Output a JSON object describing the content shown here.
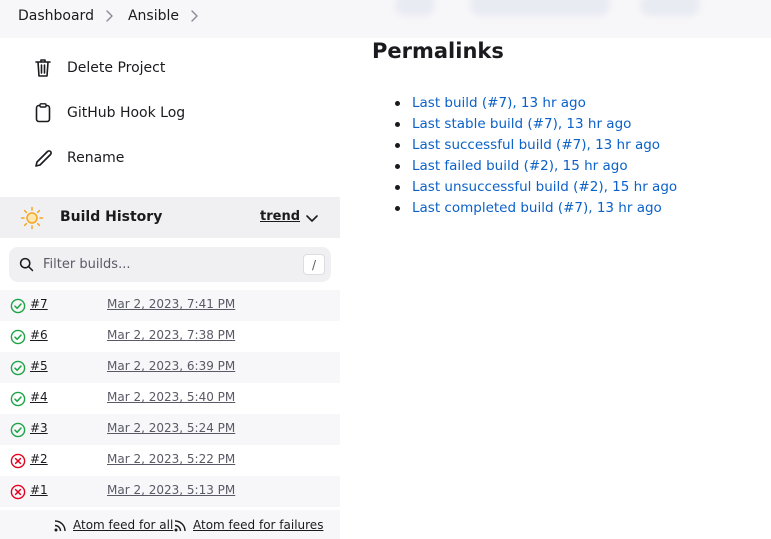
{
  "breadcrumb": {
    "items": [
      "Dashboard",
      "Ansible"
    ]
  },
  "sidebar": {
    "tasks": [
      {
        "label": "Delete Project",
        "icon": "trash-icon"
      },
      {
        "label": "GitHub Hook Log",
        "icon": "clipboard-icon"
      },
      {
        "label": "Rename",
        "icon": "pencil-icon"
      }
    ]
  },
  "build_history": {
    "title": "Build History",
    "trend_label": "trend",
    "filter_placeholder": "Filter builds...",
    "shortcut_key": "/",
    "builds": [
      {
        "number": "#7",
        "time": "Mar 2, 2023, 7:41 PM",
        "status": "success"
      },
      {
        "number": "#6",
        "time": "Mar 2, 2023, 7:38 PM",
        "status": "success"
      },
      {
        "number": "#5",
        "time": "Mar 2, 2023, 6:39 PM",
        "status": "success"
      },
      {
        "number": "#4",
        "time": "Mar 2, 2023, 5:40 PM",
        "status": "success"
      },
      {
        "number": "#3",
        "time": "Mar 2, 2023, 5:24 PM",
        "status": "success"
      },
      {
        "number": "#2",
        "time": "Mar 2, 2023, 5:22 PM",
        "status": "failed"
      },
      {
        "number": "#1",
        "time": "Mar 2, 2023, 5:13 PM",
        "status": "failed"
      }
    ],
    "feeds": {
      "all": "Atom feed for all",
      "failures": "Atom feed for failures"
    }
  },
  "permalinks": {
    "title": "Permalinks",
    "links": [
      "Last build (#7), 13 hr ago",
      "Last stable build (#7), 13 hr ago",
      "Last successful build (#7), 13 hr ago",
      "Last failed build (#2), 15 hr ago",
      "Last unsuccessful build (#2), 15 hr ago",
      "Last completed build (#7), 13 hr ago"
    ]
  },
  "colors": {
    "success": "#1ea446",
    "failed": "#e6001f",
    "link": "#0b61c8",
    "sun": "#f5a623"
  }
}
